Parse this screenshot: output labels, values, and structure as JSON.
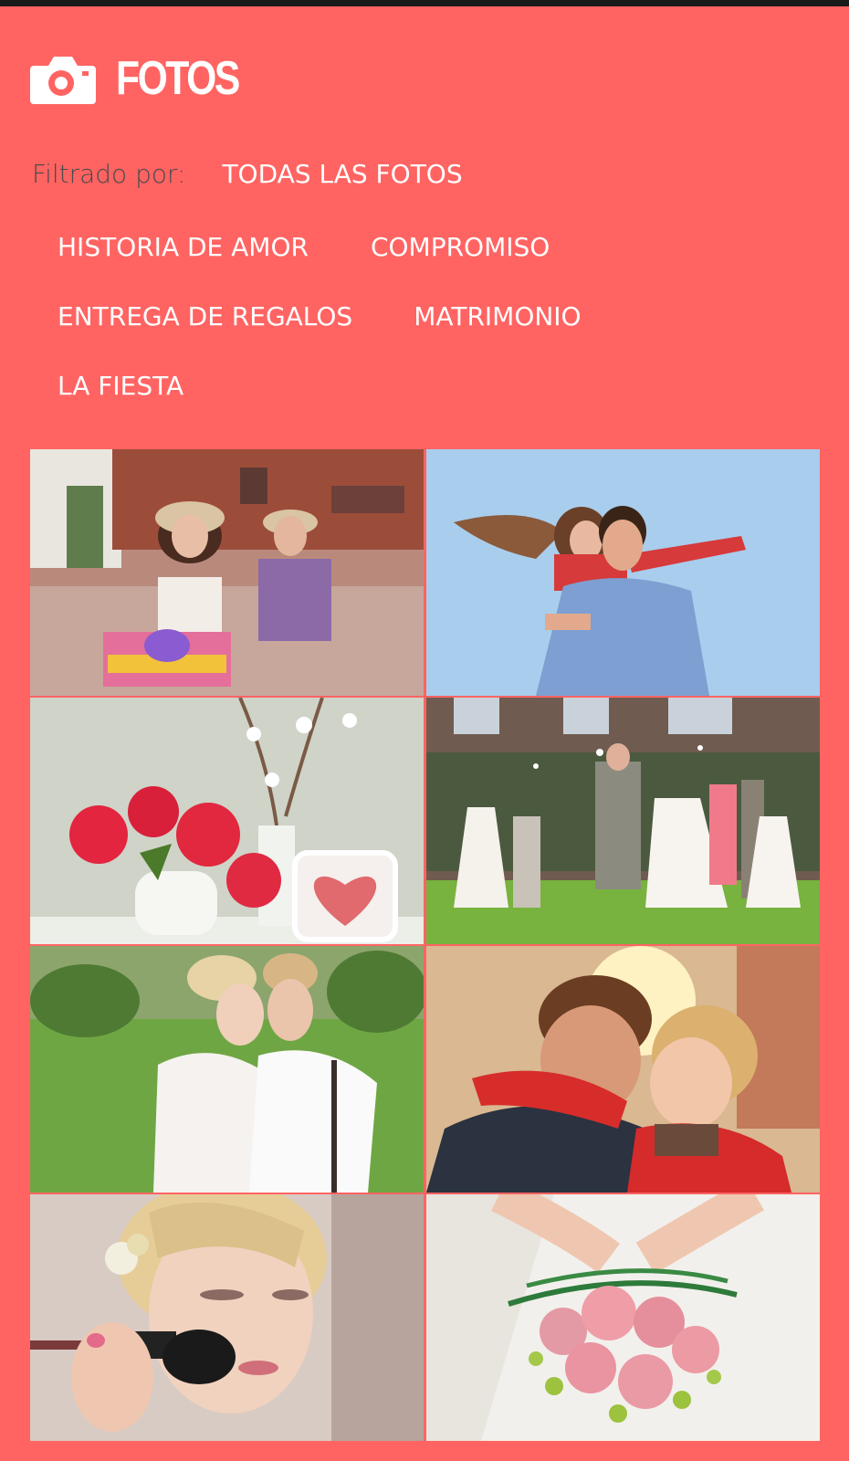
{
  "header": {
    "title": "FOTOS",
    "icon": "camera-icon"
  },
  "filter": {
    "label": "Filtrado por:",
    "selected": "TODAS LAS FOTOS",
    "options_rows": [
      [
        "HISTORIA DE AMOR",
        "COMPROMISO"
      ],
      [
        "ENTREGA DE REGALOS",
        "MATRIMONIO"
      ],
      [
        "LA FIESTA"
      ]
    ]
  },
  "colors": {
    "background": "#FF6462",
    "text": "#FFFFFF",
    "label": "#4A4A4A"
  },
  "photos": [
    "couple-on-bicycle",
    "piggyback-couple-sky",
    "red-peonies-heart-frame",
    "wedding-party-on-lawn",
    "bride-groom-embrace-field",
    "couple-hugging-sunset",
    "bride-makeup-brush",
    "bride-rose-bouquet"
  ]
}
